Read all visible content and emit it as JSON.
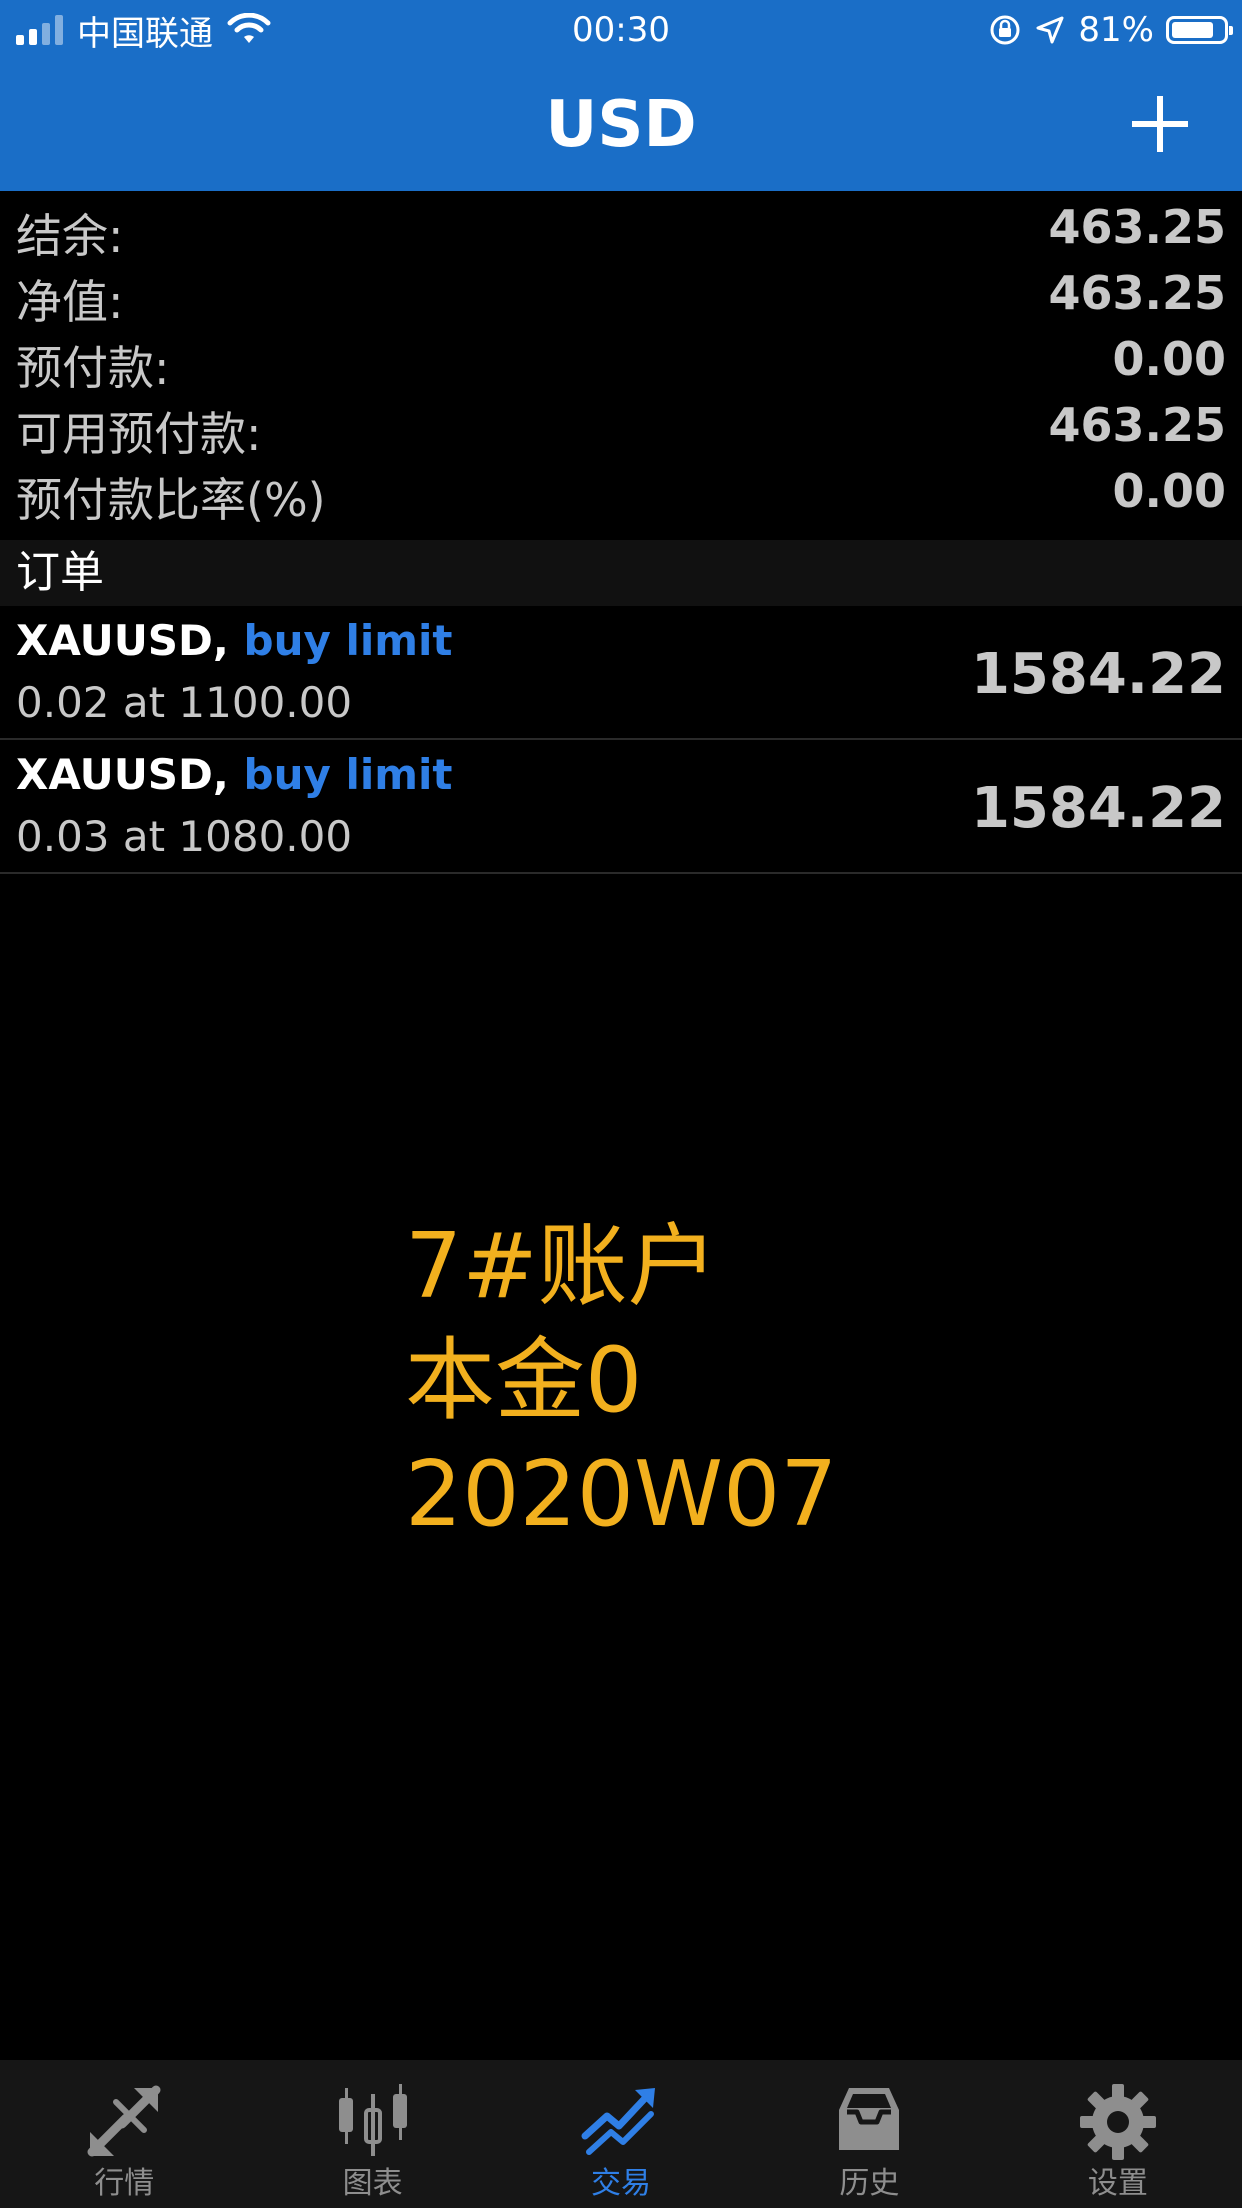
{
  "status": {
    "carrier": "中国联通",
    "time": "00:30",
    "battery_percent": "81%",
    "battery_level": 0.81,
    "signal_bars_active": 2,
    "signal_bars_total": 4
  },
  "nav": {
    "title": "USD",
    "add_icon": "plus-icon"
  },
  "summary": [
    {
      "label": "结余:",
      "value": "463.25"
    },
    {
      "label": "净值:",
      "value": "463.25"
    },
    {
      "label": "预付款:",
      "value": "0.00"
    },
    {
      "label": "可用预付款:",
      "value": "463.25"
    },
    {
      "label": "预付款比率(%)",
      "value": "0.00"
    }
  ],
  "orders_section": {
    "title": "订单"
  },
  "orders": [
    {
      "symbol": "XAUUSD,",
      "type": "buy limit",
      "detail": "0.02 at 1100.00",
      "price": "1584.22"
    },
    {
      "symbol": "XAUUSD,",
      "type": "buy limit",
      "detail": "0.03 at 1080.00",
      "price": "1584.22"
    }
  ],
  "annotation": {
    "line1": "7#账户",
    "line2": "本金0",
    "line3": "2020W07"
  },
  "tabs": [
    {
      "label": "行情",
      "icon": "quotes-arrows-icon",
      "active": false
    },
    {
      "label": "图表",
      "icon": "candlestick-chart-icon",
      "active": false
    },
    {
      "label": "交易",
      "icon": "trade-trend-icon",
      "active": true
    },
    {
      "label": "历史",
      "icon": "history-inbox-icon",
      "active": false
    },
    {
      "label": "设置",
      "icon": "gear-icon",
      "active": false
    }
  ],
  "colors": {
    "nav_blue": "#1a6ec7",
    "accent_blue": "#2f7fe6",
    "annotation_yellow": "#f2b01e",
    "background": "#000000"
  }
}
